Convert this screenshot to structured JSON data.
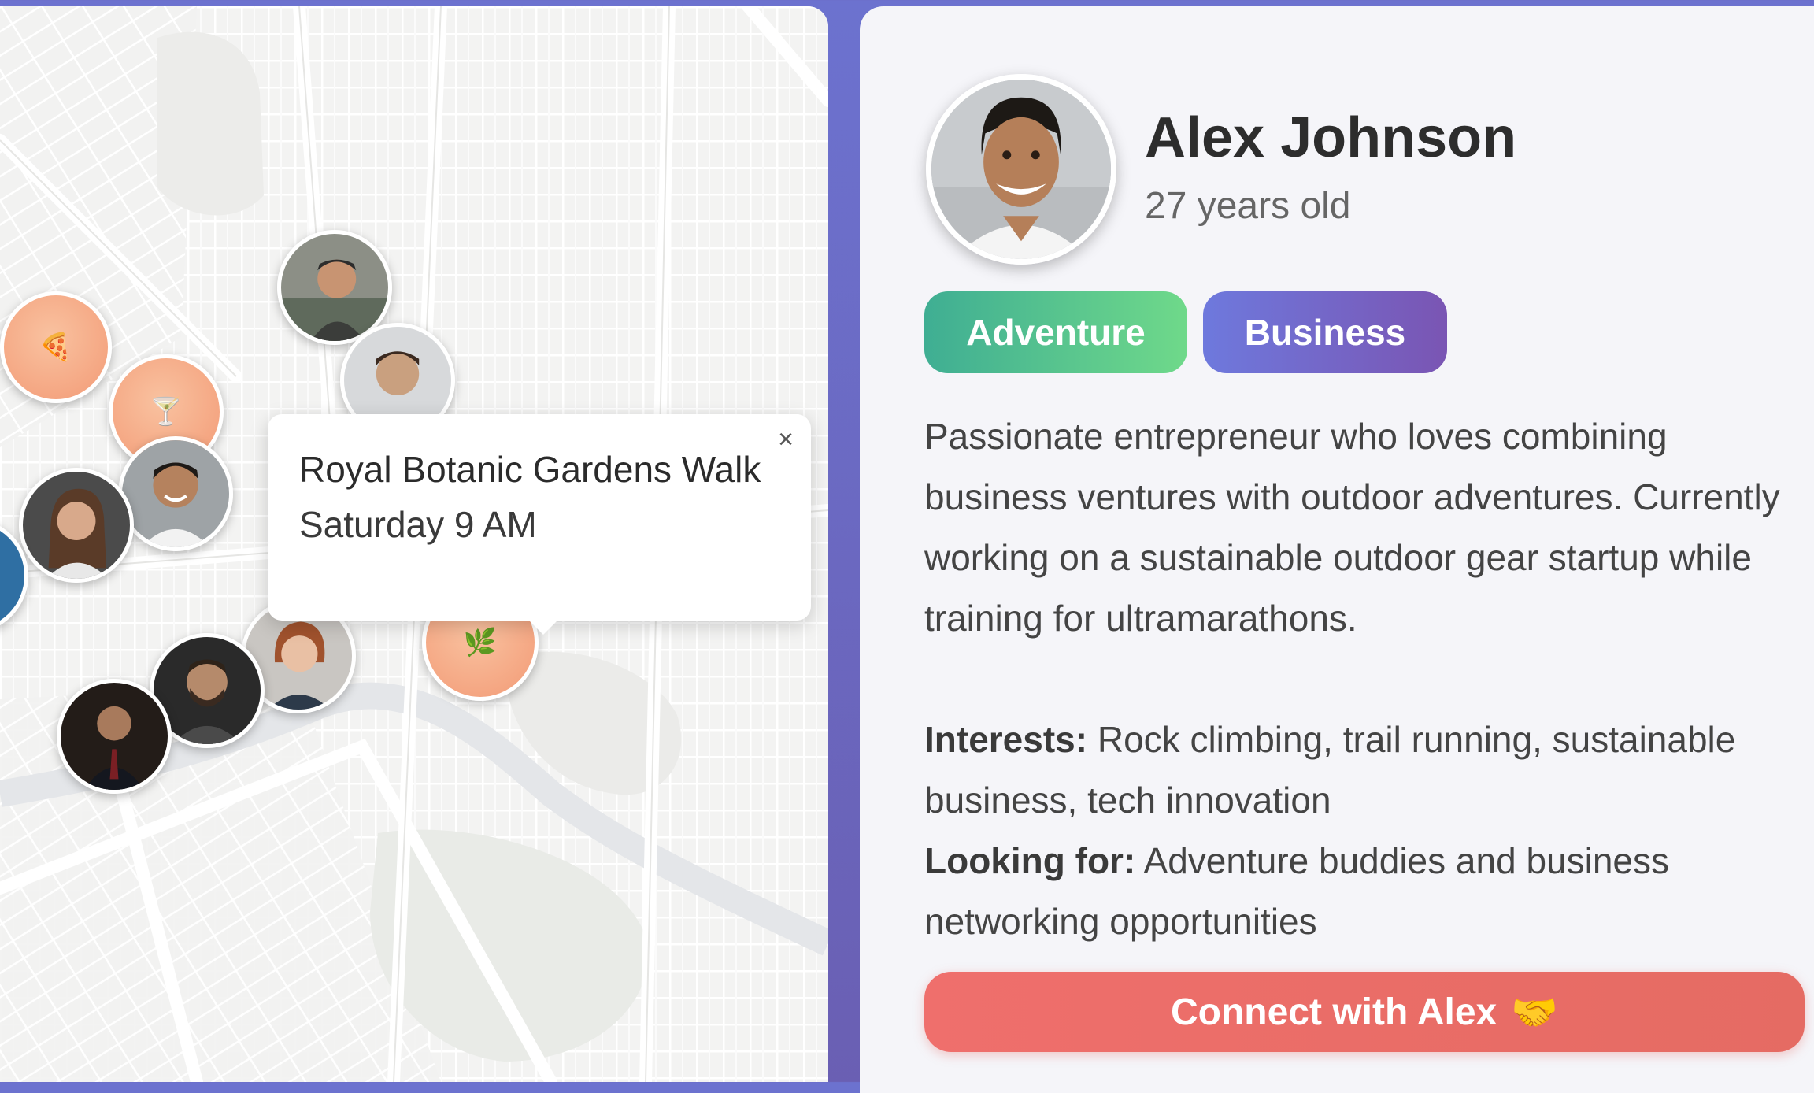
{
  "popup": {
    "title": "Royal Botanic Gardens Walk",
    "time": "Saturday 9 AM",
    "close_symbol": "×"
  },
  "map": {
    "activity_markers": [
      {
        "icon": "pizza-icon",
        "glyph": "🍕"
      },
      {
        "icon": "cocktail-icon",
        "glyph": "🍸"
      },
      {
        "icon": "leaf-icon",
        "glyph": "🌿"
      }
    ]
  },
  "profile": {
    "name": "Alex Johnson",
    "age": "27 years old",
    "tags": [
      "Adventure",
      "Business"
    ],
    "bio": "Passionate entrepreneur who loves combining business ventures with outdoor adventures. Currently working on a sustainable outdoor gear startup while training for ultramarathons.",
    "interests_label": "Interests:",
    "interests": "Rock climbing, trail running, sustainable business, tech innovation",
    "looking_label": "Looking for:",
    "looking": "Adventure buddies and business networking opportunities",
    "connect_label": "Connect with Alex",
    "connect_icon": "handshake-icon",
    "connect_glyph": "🤝"
  },
  "colors": {
    "tag_adventure": [
      "#3fae93",
      "#6fd98a"
    ],
    "tag_business": [
      "#6e79dd",
      "#7a55b3"
    ],
    "connect_button": "#ea6d68",
    "background": "#6c72cf"
  }
}
